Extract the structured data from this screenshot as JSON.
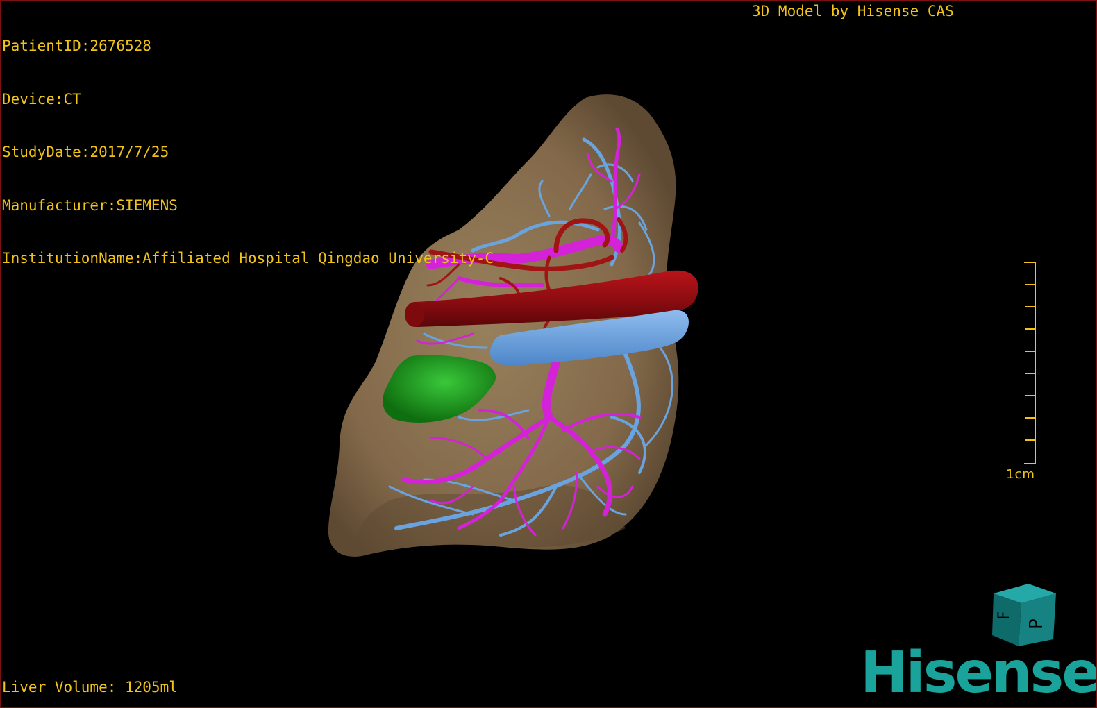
{
  "overlay": {
    "patient_id": "PatientID:2676528",
    "device": "Device:CT",
    "study_date": "StudyDate:2017/7/25",
    "manufacturer": "Manufacturer:SIEMENS",
    "institution": "InstitutionName:Affiliated Hospital Qingdao University-C",
    "model_credit": "3D Model by Hisense CAS",
    "liver_volume": "Liver Volume: 1205ml"
  },
  "scale_bar": {
    "label": "1cm",
    "color": "#f2c418"
  },
  "orientation_cube": {
    "face_front": "P",
    "face_side": "F",
    "color": "#1a8c8c"
  },
  "logo": {
    "text": "Hisense",
    "color": "#1aa39a"
  },
  "model_colors": {
    "liver": "#8a7250",
    "portal_vein": "#d422d8",
    "hepatic_vein": "#6aa4e0",
    "artery": "#a01414",
    "gallbladder": "#1f9a1f"
  }
}
